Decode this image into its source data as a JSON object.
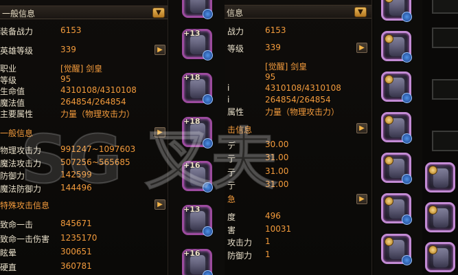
{
  "left_panel": {
    "header": "一般信息",
    "combat": {
      "label": "装备战力",
      "value": "6153"
    },
    "hero_level": {
      "label": "英雄等级",
      "value": "339"
    },
    "basic": [
      {
        "label": "职业",
        "value": "[觉醒] 剑皇"
      },
      {
        "label": "等级",
        "value": "95"
      },
      {
        "label": "生命值",
        "value": "4310108/4310108"
      },
      {
        "label": "魔法值",
        "value": "264854/264854"
      },
      {
        "label": "主要属性",
        "value": "力量（物理攻击力）"
      }
    ],
    "section_general": "一般信息",
    "general": [
      {
        "label": "物理攻击力",
        "value": "991247~1097603"
      },
      {
        "label": "魔法攻击力",
        "value": "507256~565685"
      },
      {
        "label": "防御力",
        "value": "142599"
      },
      {
        "label": "魔法防御力",
        "value": "144496"
      }
    ],
    "section_special": "特殊攻击信息",
    "special": [
      {
        "label": "致命一击",
        "value": "845671"
      },
      {
        "label": "致命一击伤害",
        "value": "1235170"
      },
      {
        "label": "眩晕",
        "value": "300651"
      },
      {
        "label": "硬直",
        "value": "360781"
      }
    ]
  },
  "mid_slots": [
    "+13",
    "+18",
    "+18",
    "+16",
    "+13",
    "+16"
  ],
  "right_panel": {
    "header": "信息",
    "combat": {
      "label": "战力",
      "value": "6153"
    },
    "hero_level": {
      "label": "等级",
      "value": "339"
    },
    "basic": [
      {
        "label": "",
        "value": "[觉醒] 剑皇"
      },
      {
        "label": "",
        "value": "95"
      },
      {
        "label": "i",
        "value": "4310108/4310108"
      },
      {
        "label": "i",
        "value": "264854/264854"
      },
      {
        "label": "属性",
        "value": "力量（物理攻击力）"
      }
    ],
    "section_attack": "击信息",
    "attack": [
      {
        "label": "デ",
        "value": "30.00"
      },
      {
        "label": "亍",
        "value": "31.00"
      },
      {
        "label": "亍",
        "value": "31.00"
      },
      {
        "label": "亍",
        "value": "31.00"
      }
    ],
    "section_info": "急",
    "info": [
      {
        "label": "度",
        "value": "496"
      },
      {
        "label": "害",
        "value": "10031"
      },
      {
        "label": "攻击力",
        "value": "1"
      },
      {
        "label": "防御力",
        "value": "1"
      }
    ]
  },
  "watermark": "SG 叉夫",
  "colors": {
    "value": "#f39b3c",
    "label": "#e8dfc9",
    "slot_border": "#9c4b9e"
  }
}
